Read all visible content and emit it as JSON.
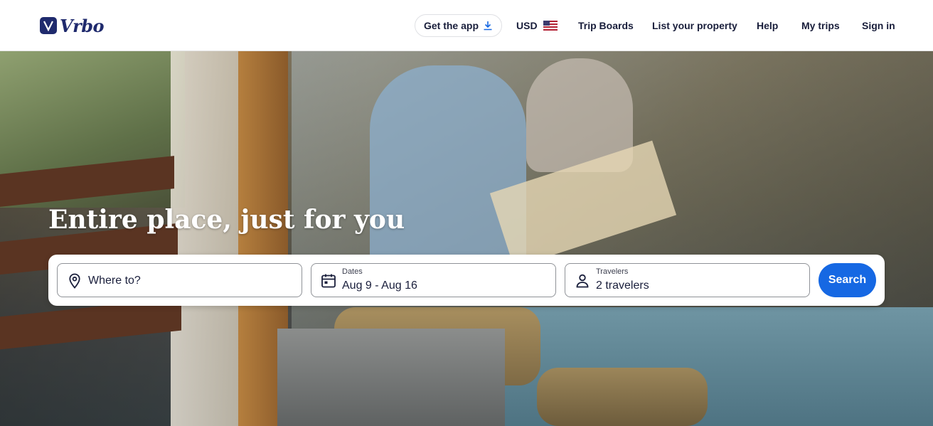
{
  "header": {
    "brand": "Vrbo",
    "get_app_label": "Get the app",
    "currency_label": "USD",
    "nav_items": [
      "Trip Boards",
      "List your property",
      "Help",
      "My trips",
      "Sign in"
    ]
  },
  "hero": {
    "headline": "Entire place, just for you"
  },
  "search": {
    "destination_placeholder": "Where to?",
    "dates_label": "Dates",
    "dates_value": "Aug 9 - Aug 16",
    "travelers_label": "Travelers",
    "travelers_value": "2 travelers",
    "button_label": "Search"
  },
  "colors": {
    "brand_navy": "#1f2a6d",
    "primary_button": "#1668e3",
    "text_primary": "#191e3b",
    "field_border": "#8f9297"
  },
  "icons": {
    "logo": "vrbo-logo-icon",
    "download": "download-icon",
    "flag": "us-flag-icon",
    "destination": "map-pin-icon",
    "dates": "calendar-icon",
    "travelers": "person-icon"
  }
}
